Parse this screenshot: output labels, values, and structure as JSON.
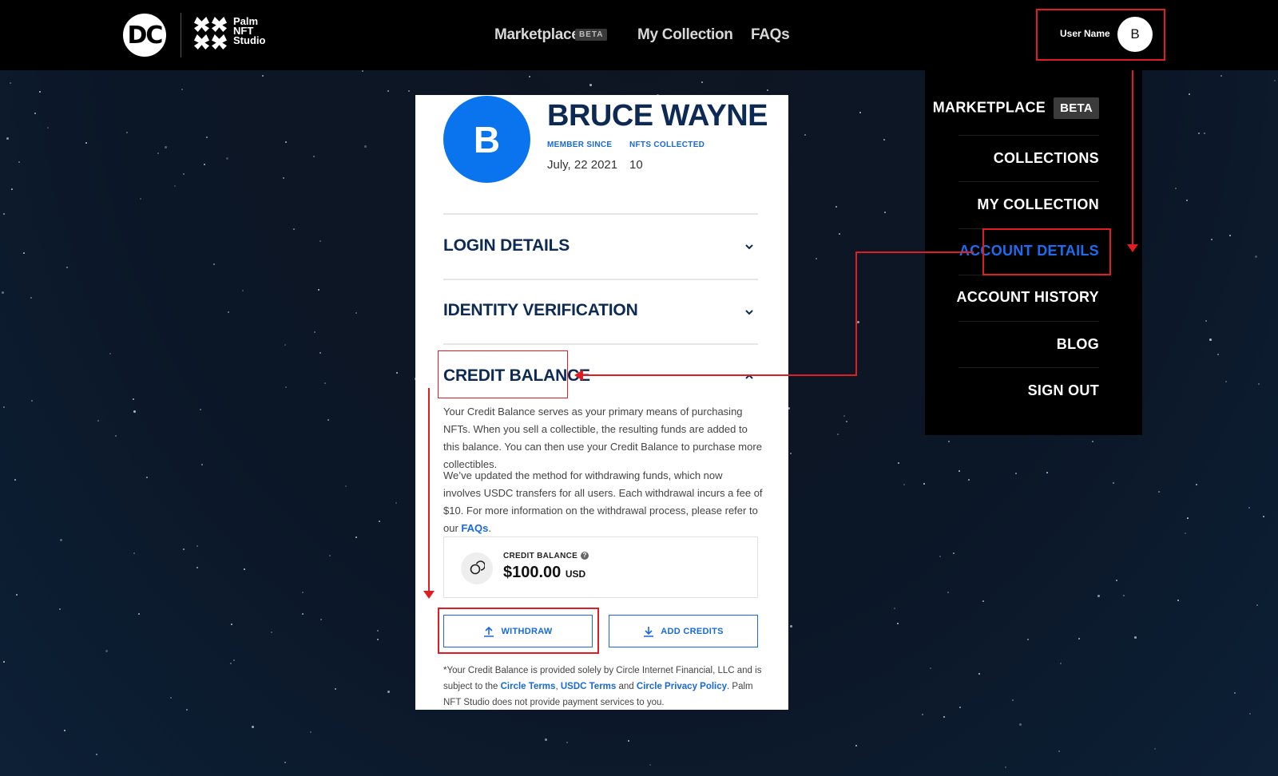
{
  "header": {
    "dc_logo_text": "DC",
    "studio_lines": [
      "Palm",
      "NFT",
      "Studio"
    ],
    "nav": [
      {
        "label": "Marketplace"
      },
      {
        "label": "My Collection"
      },
      {
        "label": "FAQs"
      }
    ],
    "beta_label": "BETA",
    "user_name": "User Name",
    "avatar_letter": "B"
  },
  "menu": {
    "items": [
      {
        "label": "MARKETPLACE",
        "badge": "BETA"
      },
      {
        "label": "COLLECTIONS"
      },
      {
        "label": "MY COLLECTION"
      },
      {
        "label": "ACCOUNT DETAILS",
        "active": true
      },
      {
        "label": "ACCOUNT HISTORY"
      },
      {
        "label": "BLOG"
      },
      {
        "label": "SIGN OUT"
      }
    ],
    "active_color": "#1f6bf0"
  },
  "profile": {
    "avatar_letter": "B",
    "name": "BRUCE WAYNE",
    "member_since_label": "MEMBER SINCE",
    "member_since_value": "July, 22 2021",
    "nfts_label": "NFTS COLLECTED",
    "nfts_value": "10"
  },
  "sections": {
    "login": "LOGIN DETAILS",
    "identity": "IDENTITY VERIFICATION",
    "credit": "CREDIT BALANCE"
  },
  "credit": {
    "para1": "Your Credit Balance serves as your primary means of purchasing NFTs. When you sell a collectible, the resulting funds are added to this balance. You can then use your Credit Balance to purchase more collectibles.",
    "para2_pre": "We’ve updated the method for withdrawing funds, which now involves USDC transfers for all users. Each withdrawal incurs a fee of $10. For more information on the withdrawal process, please refer to our",
    "para2_link": "FAQs",
    "para2_post": ".",
    "balance_label": "CREDIT BALANCE",
    "balance_value": "$100.00",
    "balance_currency": "USD",
    "withdraw_label": "WITHDRAW",
    "add_credits_label": "ADD CREDITS"
  },
  "footnote": {
    "pre": "*Your Credit Balance is provided solely by Circle Internet Financial, LLC and is subject to the",
    "link1": "Circle Terms",
    "sep1": ",",
    "link2": "USDC Terms",
    "and": "and",
    "link3": "Circle Privacy Policy",
    "post": ". Palm NFT Studio does not provide payment services to you."
  },
  "colors": {
    "accent": "#1769dc",
    "navy": "#0d2a55",
    "annotation_red": "#e01d22"
  }
}
